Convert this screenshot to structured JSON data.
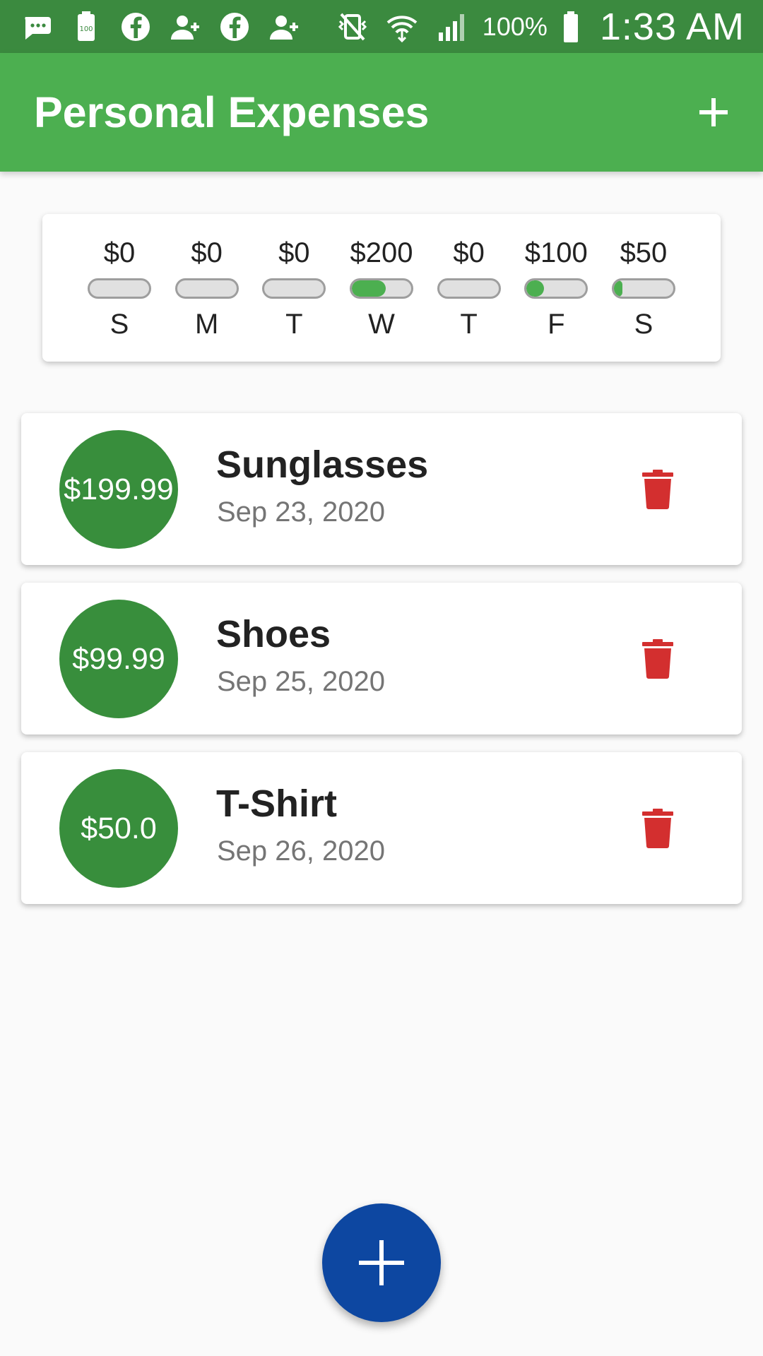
{
  "status_bar": {
    "battery_percent": "100%",
    "time": "1:33 AM",
    "icons": [
      "message-icon",
      "battery-100-icon",
      "facebook-icon",
      "add-contact-icon",
      "facebook-icon",
      "add-contact-icon",
      "vibrate-off-icon",
      "wifi-icon",
      "signal-icon",
      "battery-icon"
    ]
  },
  "app_bar": {
    "title": "Personal Expenses",
    "add_icon": "plus-icon"
  },
  "chart": {
    "days": [
      {
        "amount": "$0",
        "letter": "S",
        "fraction": 0
      },
      {
        "amount": "$0",
        "letter": "M",
        "fraction": 0
      },
      {
        "amount": "$0",
        "letter": "T",
        "fraction": 0
      },
      {
        "amount": "$200",
        "letter": "W",
        "fraction": 0.57
      },
      {
        "amount": "$0",
        "letter": "T",
        "fraction": 0
      },
      {
        "amount": "$100",
        "letter": "F",
        "fraction": 0.29
      },
      {
        "amount": "$50",
        "letter": "S",
        "fraction": 0.14
      }
    ],
    "fill_color": "#4caf50"
  },
  "expenses": [
    {
      "amount": "$199.99",
      "title": "Sunglasses",
      "date": "Sep 23, 2020"
    },
    {
      "amount": "$99.99",
      "title": "Shoes",
      "date": "Sep 25, 2020"
    },
    {
      "amount": "$50.0",
      "title": "T-Shirt",
      "date": "Sep 26, 2020"
    }
  ],
  "colors": {
    "status_bar": "#3b8a3f",
    "app_bar": "#4caf50",
    "amount_circle": "#388e3c",
    "delete": "#d32f2f",
    "fab": "#0d47a1"
  },
  "fab": {
    "icon": "plus-icon"
  }
}
